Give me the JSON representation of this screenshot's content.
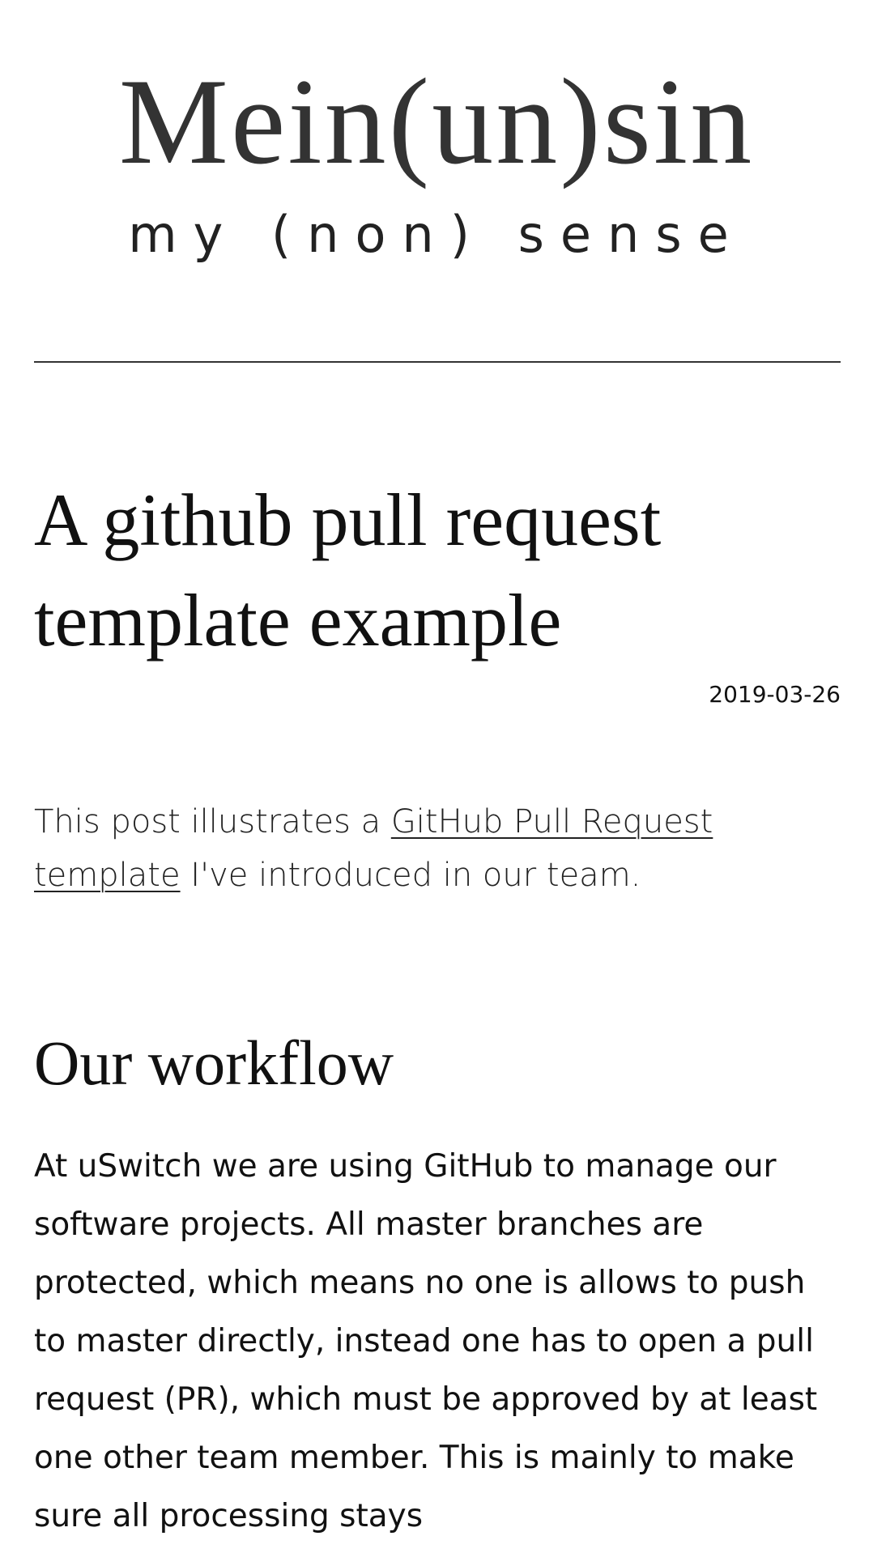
{
  "header": {
    "site_title": "Mein(un)sin",
    "site_tagline": "my (non) sense"
  },
  "post": {
    "title": "A github pull request template example",
    "date": "2019-03-26",
    "intro_before": "This post illustrates a ",
    "intro_link": "GitHub Pull Request template",
    "intro_after": " I've introduced in our team.",
    "section_heading": "Our workflow",
    "section_body": "At uSwitch we are using GitHub to manage our software projects. All master branches are protected, which means no one is allows to push to master directly, instead one has to open a pull request (PR), which must be approved by at least one other team member. This is mainly to make sure all processing stays"
  }
}
